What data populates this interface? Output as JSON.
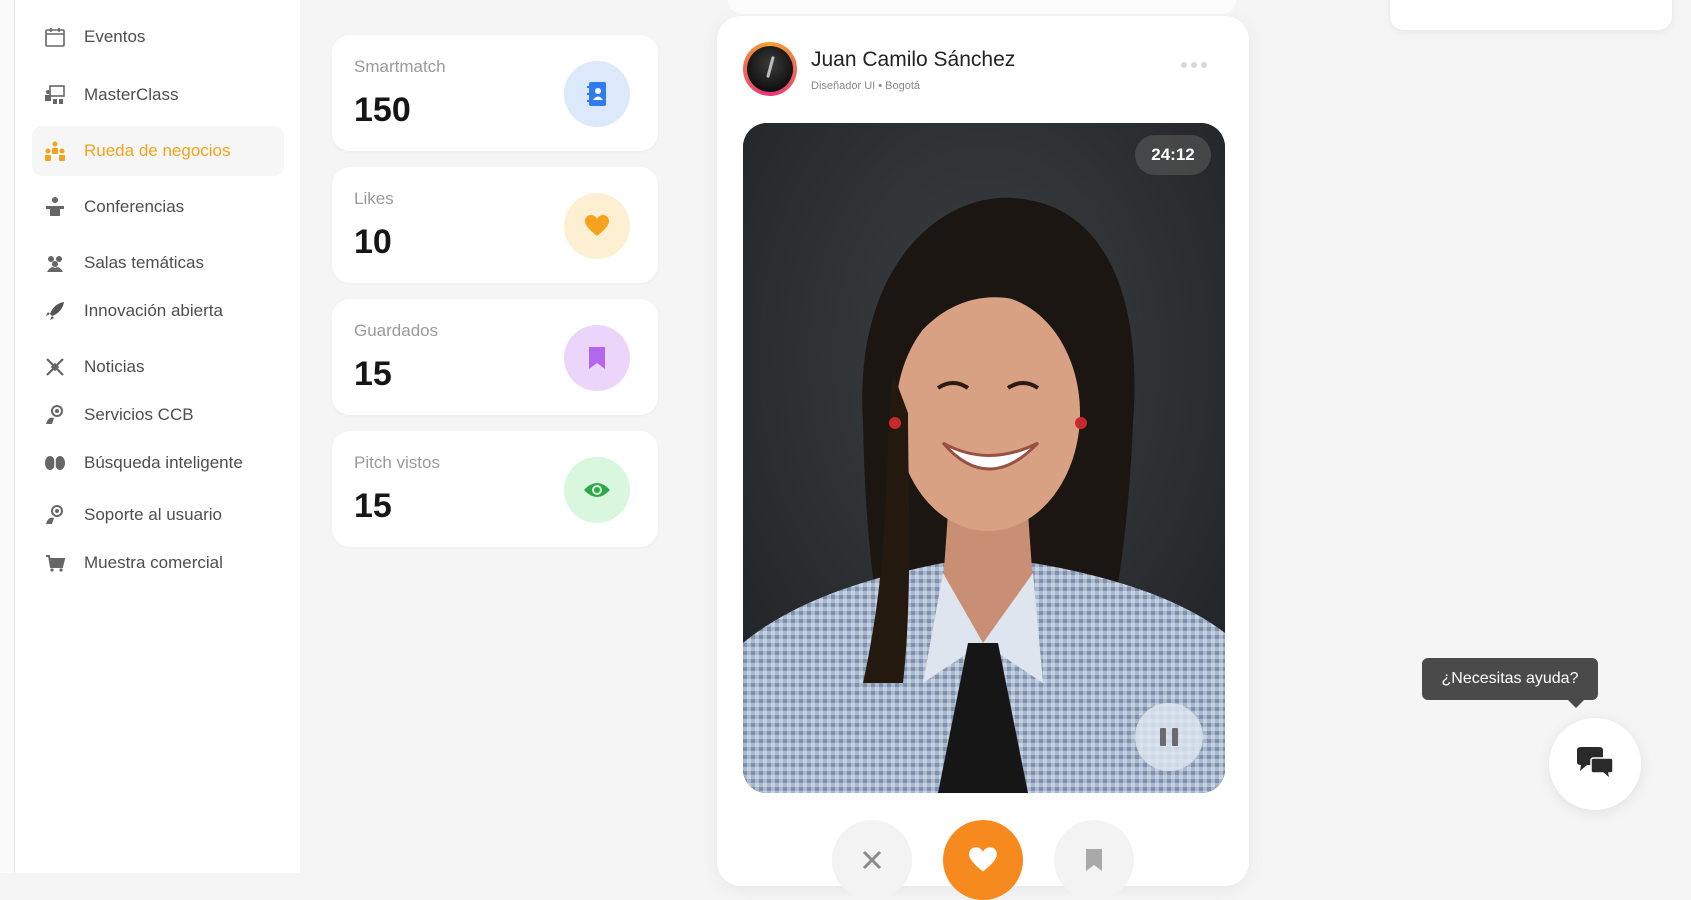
{
  "sidebar": {
    "items": [
      {
        "label": "Eventos",
        "icon": "calendar-icon"
      },
      {
        "label": "MasterClass",
        "icon": "classroom-icon"
      },
      {
        "label": "Rueda de negocios",
        "icon": "people-network-icon",
        "active": true
      },
      {
        "label": "Conferencias",
        "icon": "speaker-icon"
      },
      {
        "label": "Salas temáticas",
        "icon": "group-icon"
      },
      {
        "label": "Innovación abierta",
        "icon": "rocket-icon"
      },
      {
        "label": "Noticias",
        "icon": "satellite-icon"
      },
      {
        "label": "Servicios CCB",
        "icon": "support-agent-icon"
      },
      {
        "label": "Búsqueda inteligente",
        "icon": "brain-icon"
      },
      {
        "label": "Soporte al usuario",
        "icon": "support-agent-icon"
      },
      {
        "label": "Muestra comercial",
        "icon": "cart-icon"
      }
    ],
    "active_color": "#f3a31a"
  },
  "stats": [
    {
      "label": "Smartmatch",
      "value": "150",
      "icon": "contact-book-icon",
      "badge_bg": "#dbe9fb",
      "icon_color": "#2f7bf0"
    },
    {
      "label": "Likes",
      "value": "10",
      "icon": "heart-icon",
      "badge_bg": "#fcefd2",
      "icon_color": "#f6a21c"
    },
    {
      "label": "Guardados",
      "value": "15",
      "icon": "bookmark-icon",
      "badge_bg": "#ecd5fa",
      "icon_color": "#b467ec"
    },
    {
      "label": "Pitch vistos",
      "value": "15",
      "icon": "eye-icon",
      "badge_bg": "#d8f7de",
      "icon_color": "#2fa84a"
    }
  ],
  "profile": {
    "name": "Juan Camilo Sánchez",
    "subtitle": "Diseñador UI • Bogotá",
    "timer": "24:12"
  },
  "help": {
    "tooltip": "¿Necesitas ayuda?"
  },
  "colors": {
    "accent": "#f68a1e",
    "background": "#f5f5f6"
  }
}
